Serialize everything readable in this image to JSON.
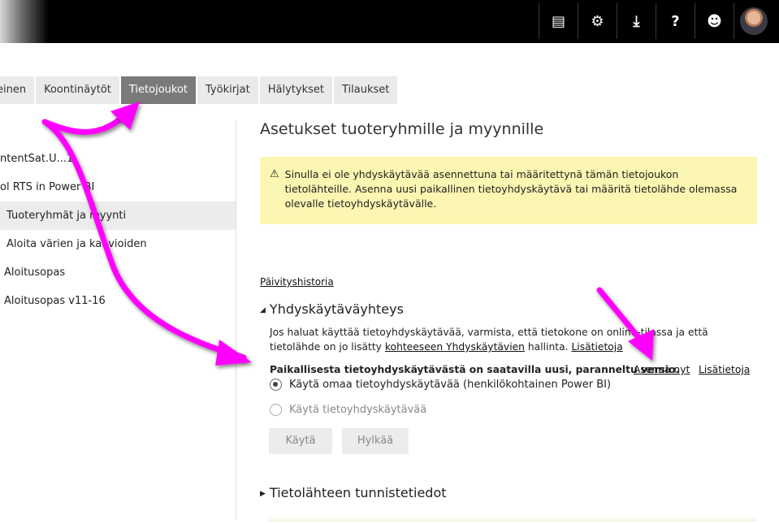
{
  "header": {
    "icons": [
      "feedback-icon",
      "gear-icon",
      "download-icon",
      "help-icon",
      "smiley-icon",
      "avatar"
    ],
    "glyphs": {
      "feedback": "▤",
      "gear": "⚙",
      "download": "⤓",
      "help": "?",
      "smiley": "☻"
    }
  },
  "tabs": [
    {
      "label": "einen"
    },
    {
      "label": "Koontinäytöt"
    },
    {
      "label": "Tietojoukot"
    },
    {
      "label": "Työkirjat"
    },
    {
      "label": "Hälytykset"
    },
    {
      "label": "Tilaukset"
    }
  ],
  "sidebar": {
    "items": [
      {
        "label": "ntentSat.U...1"
      },
      {
        "label": "ol RTS in Power BI"
      },
      {
        "label": "Tuoteryhmät ja myynti"
      },
      {
        "label": "Aloita värien ja kaavioiden"
      },
      {
        "label": "Aloitusopas"
      },
      {
        "label": "Aloitusopas v11-16"
      }
    ]
  },
  "main": {
    "title": "Asetukset tuoteryhmille ja myynnille",
    "warning": {
      "icon": "⚠",
      "text": "Sinulla ei ole yhdyskäytävää asennettuna tai määritettynä tämän tietojoukon tietolähteille. Asenna uusi paikallinen tietoyhdyskäytävä tai määritä tietolähde olemassa olevalle tietoyhdyskäytävälle."
    },
    "history_link": "Päivityshistoria",
    "gateway": {
      "heading": "Yhdyskäytäväyhteys",
      "desc_part1": "Jos haluat käyttää tietoyhdyskäytävää, varmista, että tietokone on online-tilassa ja että tietolähde on jo lisätty ",
      "desc_link": "kohteeseen Yhdyskäytävien",
      "desc_part2": " hallinta. ",
      "desc_more": "Lisätietoja",
      "update_notice": "Paikallisesta tietoyhdyskäytävästä on saatavilla uusi, paranneltu versio.",
      "install_link": "Asenna nyt",
      "more_link": "Lisätietoja",
      "option_personal": "Käytä omaa tietoyhdyskäytävää (henkilökohtainen Power BI)",
      "option_gateway": "Käytä tietoyhdyskäytävää",
      "apply_button": "Käytä",
      "discard_button": "Hylkää"
    },
    "credentials_heading": "Tietolähteen tunnistetiedot"
  },
  "annotation_color": "#ff00ff"
}
